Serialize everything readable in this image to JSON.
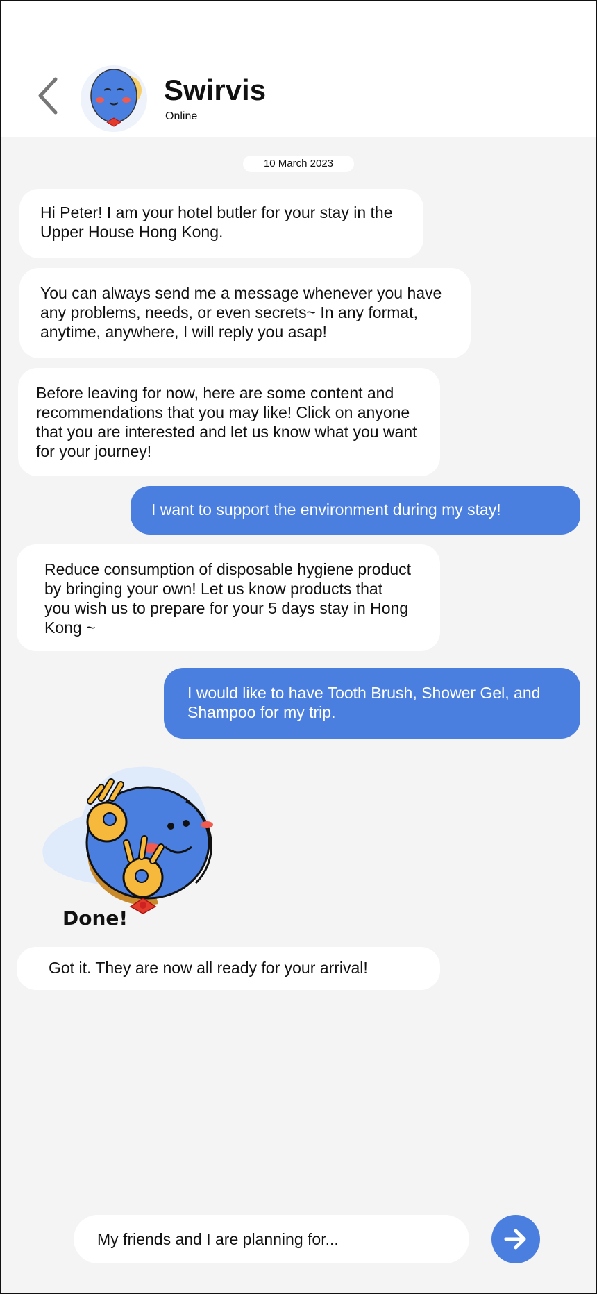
{
  "header": {
    "back_icon": "chevron-left-icon",
    "contact_name": "Swirvis",
    "status": "Online"
  },
  "chat": {
    "date": "10 March 2023",
    "messages": [
      {
        "from": "bot",
        "text": "Hi Peter! I am your hotel butler for your stay in the Upper House Hong Kong."
      },
      {
        "from": "bot",
        "text": "You can always send me a message whenever you have any problems, needs, or even secrets~ In any format, anytime, anywhere, I will reply you asap!"
      },
      {
        "from": "bot",
        "text": "Before leaving for now, here are some content and recommendations that you may like! Click on anyone that you are interested and let us know what you want for your journey!"
      },
      {
        "from": "user",
        "text": "I want to support the environment during my stay!"
      },
      {
        "from": "bot",
        "text": "Reduce consumption of disposable hygiene product by bringing your own! Let us know products that you wish us to prepare for your 5 days stay in Hong Kong ~"
      },
      {
        "from": "user",
        "text": "I would like to have Tooth Brush, Shower Gel, and Shampoo for my trip."
      },
      {
        "from": "bot",
        "text": "Got it. They are now all ready for your arrival!"
      }
    ],
    "sticker": {
      "label": "Done!",
      "icon": "mascot-ok-sticker"
    }
  },
  "composer": {
    "input_value": "My friends and I are planning for...",
    "send_icon": "arrow-right-icon"
  },
  "colors": {
    "accent": "#4a7fe0",
    "background": "#f4f4f4",
    "bubble_bot": "#ffffff"
  }
}
